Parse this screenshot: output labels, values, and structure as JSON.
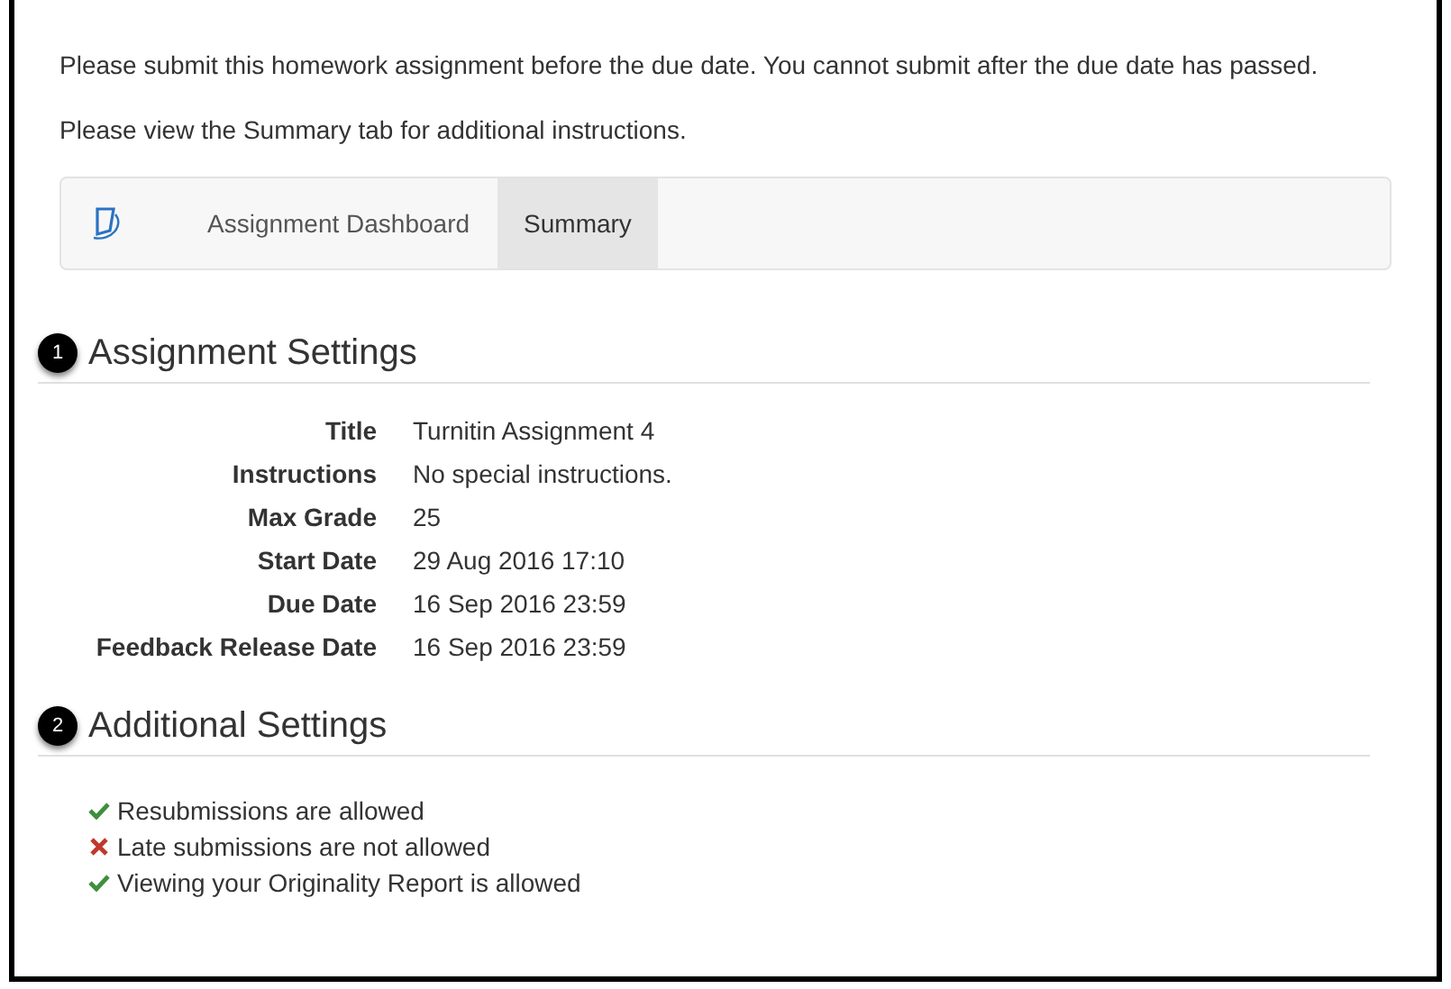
{
  "intro": [
    "Please submit this homework assignment before the due date. You cannot submit after the due date has passed.",
    "Please view the Summary tab for additional instructions."
  ],
  "tabs": [
    {
      "label": "Assignment Dashboard",
      "selected": false
    },
    {
      "label": "Summary",
      "selected": true
    }
  ],
  "sections": [
    {
      "badge": "1",
      "title": "Assignment Settings",
      "fields": [
        {
          "label": "Title",
          "value": "Turnitin Assignment 4"
        },
        {
          "label": "Instructions",
          "value": "No special instructions."
        },
        {
          "label": "Max Grade",
          "value": "25"
        },
        {
          "label": "Start Date",
          "value": "29 Aug 2016 17:10"
        },
        {
          "label": "Due Date",
          "value": "16 Sep 2016 23:59"
        },
        {
          "label": "Feedback Release Date",
          "value": "16 Sep 2016 23:59"
        }
      ]
    },
    {
      "badge": "2",
      "title": "Additional Settings",
      "items": [
        {
          "text": "Resubmissions are allowed",
          "allowed": true
        },
        {
          "text": "Late submissions are not allowed",
          "allowed": false
        },
        {
          "text": "Viewing your Originality Report is allowed",
          "allowed": true
        }
      ]
    }
  ]
}
